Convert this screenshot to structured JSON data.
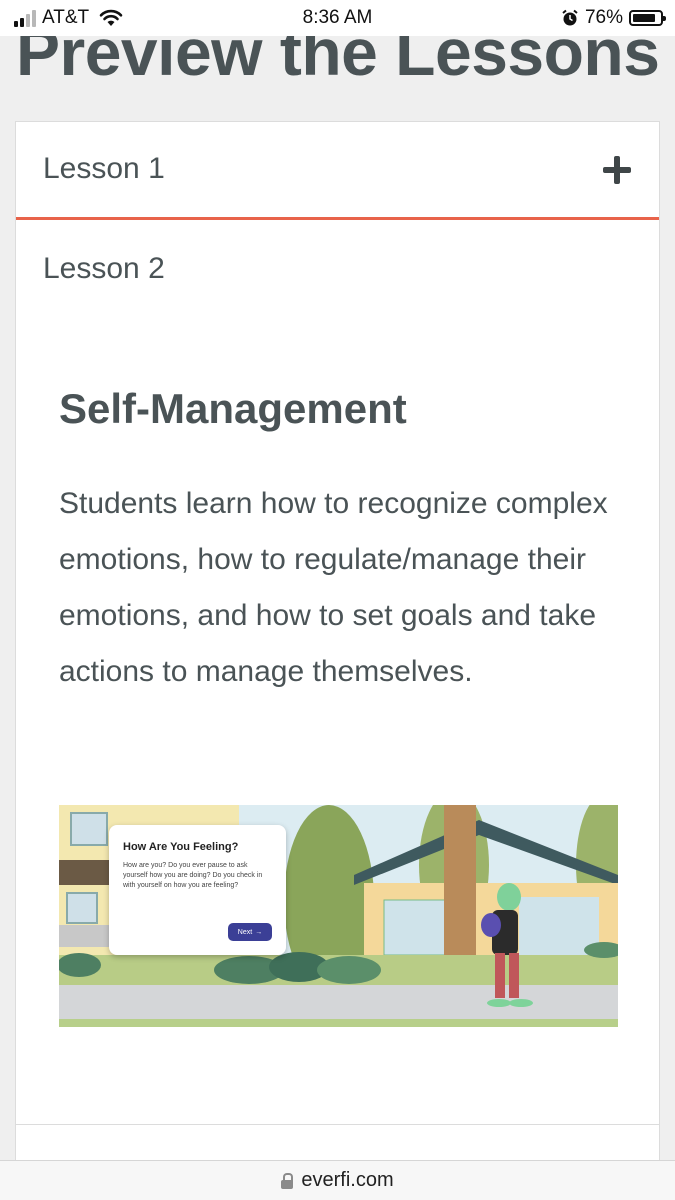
{
  "status_bar": {
    "carrier": "AT&T",
    "time": "8:36 AM",
    "battery": "76%",
    "battery_level": 0.76
  },
  "page": {
    "heading": "Preview the Lessons"
  },
  "accordion": {
    "items": [
      {
        "label": "Lesson 1",
        "icon": "plus-icon",
        "expanded": false
      },
      {
        "label": "Lesson 2",
        "expanded": true
      }
    ],
    "expanded_content": {
      "title": "Self-Management",
      "description": "Students learn how to recognize complex emotions, how to regulate/manage their emotions, and how to set goals and take actions to manage themselves."
    },
    "accent_color": "#e8634a"
  },
  "illustration": {
    "dialog_title": "How Are You Feeling?",
    "dialog_text": "How are you? Do you ever pause to ask yourself how you are doing? Do you check in with yourself on how you are feeling?",
    "next_label": "Next",
    "button_color": "#3b3f96"
  },
  "browser": {
    "url": "everfi.com"
  }
}
